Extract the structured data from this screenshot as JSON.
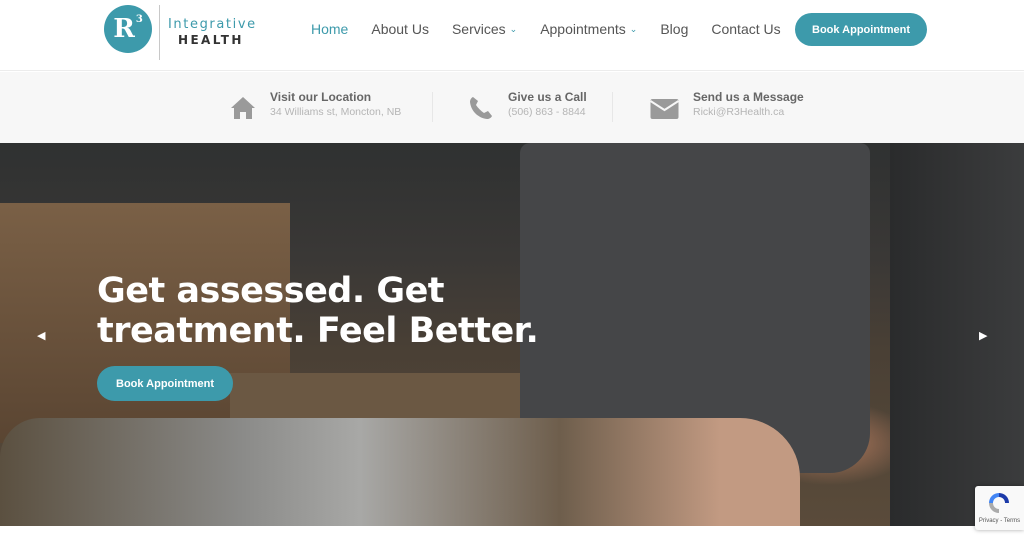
{
  "logo": {
    "mark": "R",
    "sup": "3",
    "line1": "Integrative",
    "line2": "HEALTH"
  },
  "nav": {
    "items": [
      {
        "label": "Home",
        "active": true
      },
      {
        "label": "About Us"
      },
      {
        "label": "Services",
        "dropdown": true
      },
      {
        "label": "Appointments",
        "dropdown": true
      },
      {
        "label": "Blog"
      },
      {
        "label": "Contact Us"
      }
    ],
    "cta": "Book Appointment"
  },
  "info": [
    {
      "icon": "home-icon",
      "title": "Visit our Location",
      "sub": "34 Williams st, Moncton, NB"
    },
    {
      "icon": "phone-icon",
      "title": "Give us a Call",
      "sub": "(506) 863 - 8844"
    },
    {
      "icon": "envelope-icon",
      "title": "Send us a Message",
      "sub": "Ricki@R3Health.ca"
    }
  ],
  "hero": {
    "title_line1": "Get assessed. Get",
    "title_line2": "treatment. Feel Better.",
    "cta": "Book Appointment",
    "prev": "◀",
    "next": "▶"
  },
  "recaptcha": {
    "text": "Privacy - Terms"
  },
  "colors": {
    "accent": "#3d9aab",
    "text": "#555555"
  }
}
